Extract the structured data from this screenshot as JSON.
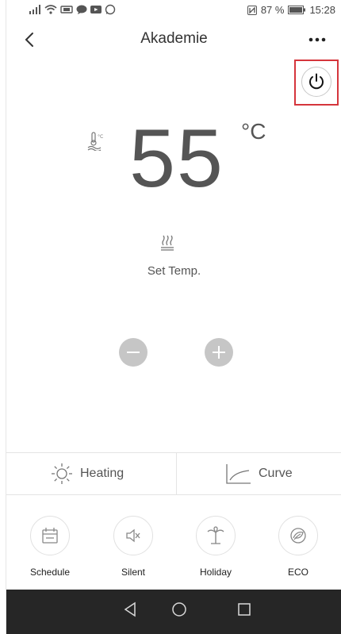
{
  "status_bar": {
    "battery_percent": "87 %",
    "time": "15:28"
  },
  "header": {
    "title": "Akademie"
  },
  "temperature": {
    "value": "55",
    "unit": "°C",
    "set_label": "Set Temp."
  },
  "modes": {
    "heating_label": "Heating",
    "curve_label": "Curve"
  },
  "functions": [
    {
      "label": "Schedule",
      "icon": "calendar-icon"
    },
    {
      "label": "Silent",
      "icon": "speaker-mute-icon"
    },
    {
      "label": "Holiday",
      "icon": "palm-tree-icon"
    },
    {
      "label": "ECO",
      "icon": "leaf-icon"
    }
  ],
  "colors": {
    "power_highlight": "#d5353c",
    "stepper": "#c6c6c6",
    "nav_bar": "#262626"
  }
}
